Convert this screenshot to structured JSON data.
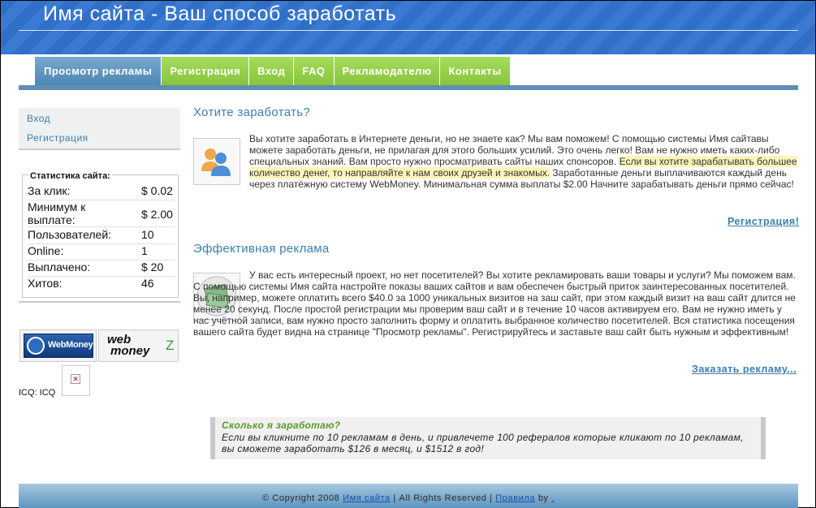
{
  "header": {
    "title": "Имя сайта - Ваш способ заработать"
  },
  "nav": {
    "tabs": [
      {
        "label": "Просмотр рекламы"
      },
      {
        "label": "Регистрация"
      },
      {
        "label": "Вход"
      },
      {
        "label": "FAQ"
      },
      {
        "label": "Рекламодателю"
      },
      {
        "label": "Контакты"
      }
    ]
  },
  "sidebar": {
    "links": [
      {
        "label": "Вход"
      },
      {
        "label": "Регистрация"
      }
    ],
    "stats": {
      "title": "Статистика сайта:",
      "rows": [
        {
          "label": "За клик:",
          "value": "$ 0.02"
        },
        {
          "label": "Минимум к выплате:",
          "value": "$ 2.00"
        },
        {
          "label": "Пользователей:",
          "value": "10"
        },
        {
          "label": "Online:",
          "value": "1"
        },
        {
          "label": "Выплачено:",
          "value": "$ 20"
        },
        {
          "label": "Хитов:",
          "value": "46"
        }
      ]
    },
    "badges": {
      "webmoney": "WebMoney",
      "wmz_web": "web",
      "wmz_money": "money",
      "wmz_z": "Z"
    },
    "icq_label": "ICQ: ICQ"
  },
  "sections": [
    {
      "title": "Хотите заработать?",
      "text_before": "Вы хотите заработать в Интернете деньги, но не знаете как? Мы вам поможем! С помощью системы Имя сайтавы можете заработать деньги, не прилагая для этого больших усилий. Это очень легко! Вам не нужно иметь каких-либо специальных знаний. Вам просто нужно просматривать сайты наших спонсоров. ",
      "text_highlight": "Если вы хотите зарабатывать большее количество денег, то направляйте к нам своих друзей и знакомых.",
      "text_after": " Заработанные деньги выплачиваются каждый день через платёжную систему WebMoney. Минимальная сумма выплаты $2.00 Начните зарабатывать деньги прямо сейчас!",
      "link": "Регистрация!"
    },
    {
      "title": "Эффективная реклама",
      "text": "У вас есть интересный проект, но нет посетителей? Вы хотите рекламировать ваши товары и услуги? Мы поможем вам. С помощью системы Имя сайта настройте показы ваших сайтов и вам обеспечен быстрый приток заинтересованных посетителей. Вы, например, можете оплатить всего $40.0 за 1000 уникальных визитов на заш сайт, при этом каждый визит на ваш сайт длится не менее 20 секунд. После простой регистрации мы проверим ваш сайт и в течение 10 часов активируем его. Вам не нужно иметь у нас учётной записи, вам нужно просто заполнить форму и оплатить выбранное количество посетителей. Вся статистика посещения вашего сайта будет видна на странице \"Просмотр рекламы\". Регистрируйтесь и заставьте ваш сайт быть нужным и эффективным!",
      "link": "Заказать рекламу..."
    }
  ],
  "quote": {
    "question": "Сколько я заработаю?",
    "answer": "Если вы кликните по 10 рекламам в день, и привлечете 100 рефералов которые кликают по 10 рекламам, вы сможете заработать $126 в месяц, и $1512 в год!"
  },
  "footer": {
    "prefix": "© Copyright 2008 ",
    "site_link": "Имя сайта",
    "middle": " | All Rights Reserved | ",
    "rules_link": "Правила",
    "suffix": " by ",
    "author_link": "."
  }
}
